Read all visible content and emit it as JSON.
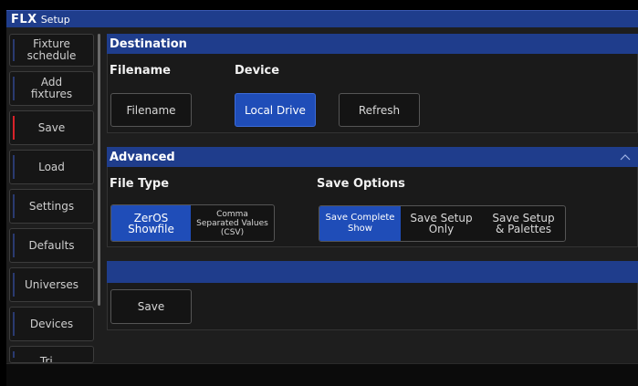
{
  "titlebar": {
    "brand": "FLX",
    "title": "Setup"
  },
  "sidebar": {
    "items": [
      {
        "label": "Fixture\nschedule",
        "active": false
      },
      {
        "label": "Add\nfixtures",
        "active": false
      },
      {
        "label": "Save",
        "active": true
      },
      {
        "label": "Load",
        "active": false
      },
      {
        "label": "Settings",
        "active": false
      },
      {
        "label": "Defaults",
        "active": false
      },
      {
        "label": "Universes",
        "active": false
      },
      {
        "label": "Devices",
        "active": false
      },
      {
        "label": "Tri...",
        "active": false
      }
    ]
  },
  "destination": {
    "header": "Destination",
    "filename_label": "Filename",
    "device_label": "Device",
    "filename_button": "Filename",
    "device_button": "Local Drive",
    "refresh_button": "Refresh"
  },
  "advanced": {
    "header": "Advanced",
    "file_type_label": "File Type",
    "save_options_label": "Save Options",
    "file_types": [
      "ZerOS\nShowfile",
      "Comma\nSeparated Values\n(CSV)"
    ],
    "save_options": [
      "Save Complete\nShow",
      "Save Setup\nOnly",
      "Save Setup\n& Palettes"
    ]
  },
  "save_panel": {
    "header": "",
    "save_button": "Save"
  },
  "colors": {
    "accent": "#1f3d8c",
    "selected": "#1f4db8",
    "active_marker": "#d8232a"
  }
}
